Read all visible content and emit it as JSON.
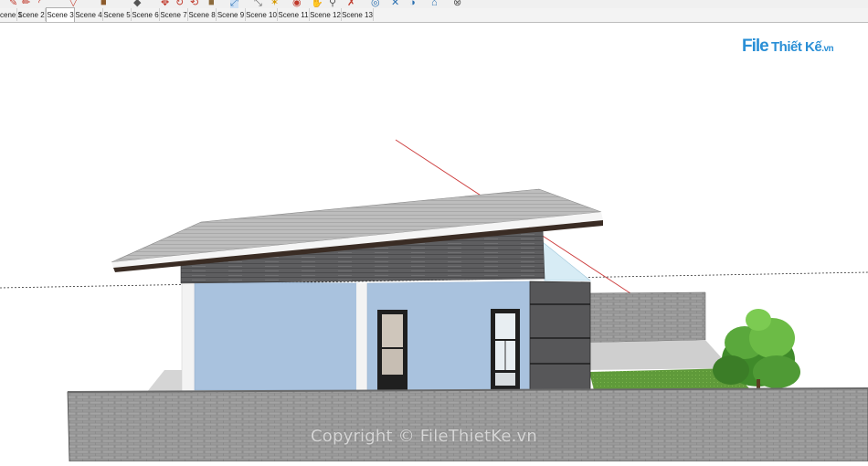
{
  "scene_tabs": [
    {
      "label": "cene 1",
      "active": false
    },
    {
      "label": "Scene 2",
      "active": false
    },
    {
      "label": "Scene 3",
      "active": true
    },
    {
      "label": "Scene 4",
      "active": false
    },
    {
      "label": "Scene 5",
      "active": false
    },
    {
      "label": "Scene 6",
      "active": false
    },
    {
      "label": "Scene 7",
      "active": false
    },
    {
      "label": "Scene 8",
      "active": false
    },
    {
      "label": "Scene 9",
      "active": false
    },
    {
      "label": "Scene 10",
      "active": false
    },
    {
      "label": "Scene 11",
      "active": false
    },
    {
      "label": "Scene 12",
      "active": false
    },
    {
      "label": "Scene 13",
      "active": false
    }
  ],
  "toolbar_icons": [
    "eraser-icon",
    "pencil-icon",
    "arc-icon",
    "push-pull-icon",
    "paint-icon",
    "offset-icon",
    "move-icon",
    "rotate-icon",
    "scale-icon",
    "tape-icon",
    "dimension-icon",
    "text-icon",
    "axes-icon",
    "orbit-icon",
    "pan-icon",
    "zoom-icon",
    "walk-icon",
    "look-icon",
    "section-icon",
    "sandbox-icon",
    "warehouse-icon",
    "extension-icon",
    "compass-icon"
  ],
  "watermark": {
    "logo_file": "File",
    "logo_rest": "Thiết Kế",
    "logo_tld": ".vn",
    "copyright": "Copyright © FileThietKe.vn"
  },
  "colors": {
    "wall_blue": "#a9c2de",
    "roof_grey": "#b8b8b8",
    "fascia_dark": "#3a2c24",
    "brick_grey": "#8a8a8a",
    "grass_green": "#5f9a3a",
    "accent_blue": "#2a8fd6"
  }
}
